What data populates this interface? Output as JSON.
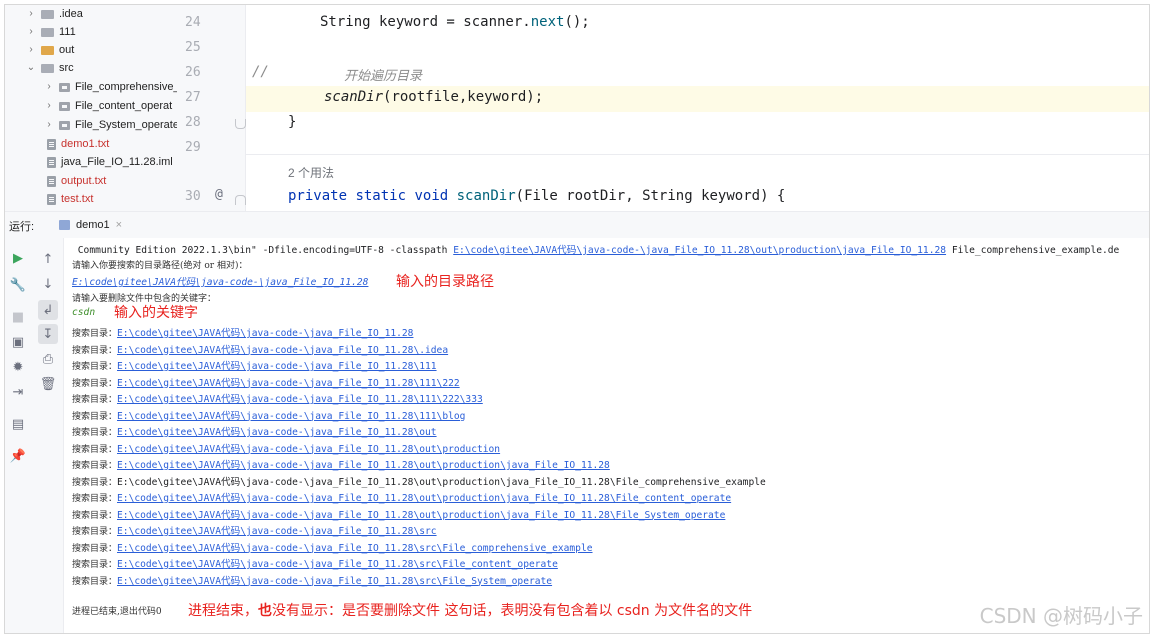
{
  "tree": {
    "items": [
      {
        "label": ".idea"
      },
      {
        "label": "111"
      },
      {
        "label": "out"
      },
      {
        "label": "src"
      },
      {
        "label": "File_comprehensive_"
      },
      {
        "label": "File_content_operat"
      },
      {
        "label": "File_System_operate"
      },
      {
        "label": "demo1.txt"
      },
      {
        "label": "java_File_IO_11.28.iml"
      },
      {
        "label": "output.txt"
      },
      {
        "label": "test.txt"
      }
    ]
  },
  "editor": {
    "line_numbers": [
      "24",
      "25",
      "26",
      "27",
      "28",
      "29",
      "30"
    ],
    "line24": {
      "pre": "String keyword = scanner.",
      "fn": "next",
      "post": "();"
    },
    "line26": {
      "slashes": "//",
      "comment": "开始遍历目录"
    },
    "line27": {
      "fn": "scanDir",
      "args": "(rootfile,keyword);"
    },
    "line28": "}",
    "usages_hint": "2 个用法",
    "line30_gutter": "@",
    "line30": {
      "kw1": "private",
      "kw2": "static",
      "kw3": "void",
      "fn": "scanDir",
      "rest": "(File rootDir, String keyword) {"
    }
  },
  "run": {
    "label": "运行:",
    "tab": "demo1",
    "close": "×"
  },
  "console": {
    "cmd_pre": " Community Edition 2022.1.3\\bin\" -Dfile.encoding=UTF-8 -classpath ",
    "cmd_link": "E:\\code\\gitee\\JAVA代码\\java-code-\\java_File_IO_11.28\\out\\production\\java_File_IO_11.28",
    "cmd_post": " File_comprehensive_example.de",
    "prompt1": "请输入你要搜索的目录路径(绝对 or 相对)：",
    "input_path": "E:\\code\\gitee\\JAVA代码\\java-code-\\java_File_IO_11.28",
    "anno_path": "输入的目录路径",
    "prompt2": "请输入要删除文件中包含的关键字：",
    "input_keyword": "csdn",
    "anno_keyword": "输入的关键字",
    "search_prefix": "搜索目录：",
    "search_lines": [
      {
        "path": "E:\\code\\gitee\\JAVA代码\\java-code-\\java_File_IO_11.28",
        "link": true
      },
      {
        "path": "E:\\code\\gitee\\JAVA代码\\java-code-\\java_File_IO_11.28\\.idea",
        "link": true
      },
      {
        "path": "E:\\code\\gitee\\JAVA代码\\java-code-\\java_File_IO_11.28\\111",
        "link": true
      },
      {
        "path": "E:\\code\\gitee\\JAVA代码\\java-code-\\java_File_IO_11.28\\111\\222",
        "link": true
      },
      {
        "path": "E:\\code\\gitee\\JAVA代码\\java-code-\\java_File_IO_11.28\\111\\222\\333",
        "link": true
      },
      {
        "path": "E:\\code\\gitee\\JAVA代码\\java-code-\\java_File_IO_11.28\\111\\blog",
        "link": true
      },
      {
        "path": "E:\\code\\gitee\\JAVA代码\\java-code-\\java_File_IO_11.28\\out",
        "link": true
      },
      {
        "path": "E:\\code\\gitee\\JAVA代码\\java-code-\\java_File_IO_11.28\\out\\production",
        "link": true
      },
      {
        "path": "E:\\code\\gitee\\JAVA代码\\java-code-\\java_File_IO_11.28\\out\\production\\java_File_IO_11.28",
        "link": true
      },
      {
        "path": "E:\\code\\gitee\\JAVA代码\\java-code-\\java_File_IO_11.28\\out\\production\\java_File_IO_11.28\\File_comprehensive_example",
        "link": false
      },
      {
        "path": "E:\\code\\gitee\\JAVA代码\\java-code-\\java_File_IO_11.28\\out\\production\\java_File_IO_11.28\\File_content_operate",
        "link": true
      },
      {
        "path": "E:\\code\\gitee\\JAVA代码\\java-code-\\java_File_IO_11.28\\out\\production\\java_File_IO_11.28\\File_System_operate",
        "link": true
      },
      {
        "path": "E:\\code\\gitee\\JAVA代码\\java-code-\\java_File_IO_11.28\\src",
        "link": true
      },
      {
        "path": "E:\\code\\gitee\\JAVA代码\\java-code-\\java_File_IO_11.28\\src\\File_comprehensive_example",
        "link": true
      },
      {
        "path": "E:\\code\\gitee\\JAVA代码\\java-code-\\java_File_IO_11.28\\src\\File_content_operate",
        "link": true
      },
      {
        "path": "E:\\code\\gitee\\JAVA代码\\java-code-\\java_File_IO_11.28\\src\\File_System_operate",
        "link": true
      }
    ],
    "exit": "进程已结束,退出代码0",
    "anno_end_a": "进程结束，",
    "anno_end_b": "也",
    "anno_end_c": "没有显示：是否要删除文件 这句话，表明没有包含着以 csdn 为文件名的文件"
  },
  "watermark": "CSDN @树码小子",
  "colors": {
    "link": "#2a5ed8",
    "annotation": "#e8231f",
    "keyword": "#0033b3",
    "run_green": "#3ba55c"
  }
}
